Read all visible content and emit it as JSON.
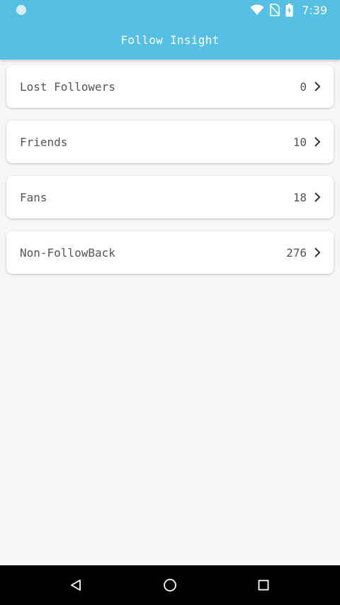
{
  "status_bar": {
    "time": "7:39",
    "icons": [
      "notification-dot-icon",
      "wifi-icon",
      "no-sim-icon",
      "battery-charging-icon"
    ]
  },
  "app_bar": {
    "title": "Follow Insight"
  },
  "items": [
    {
      "label": "Lost Followers",
      "count": "0"
    },
    {
      "label": "Friends",
      "count": "10"
    },
    {
      "label": "Fans",
      "count": "18"
    },
    {
      "label": "Non-FollowBack",
      "count": "276"
    }
  ],
  "nav_bar": {
    "icons": [
      "back-icon",
      "home-icon",
      "recents-icon"
    ]
  },
  "colors": {
    "primary": "#56bfe4",
    "background": "#f6f6f6",
    "card": "#ffffff",
    "text": "#555555"
  }
}
